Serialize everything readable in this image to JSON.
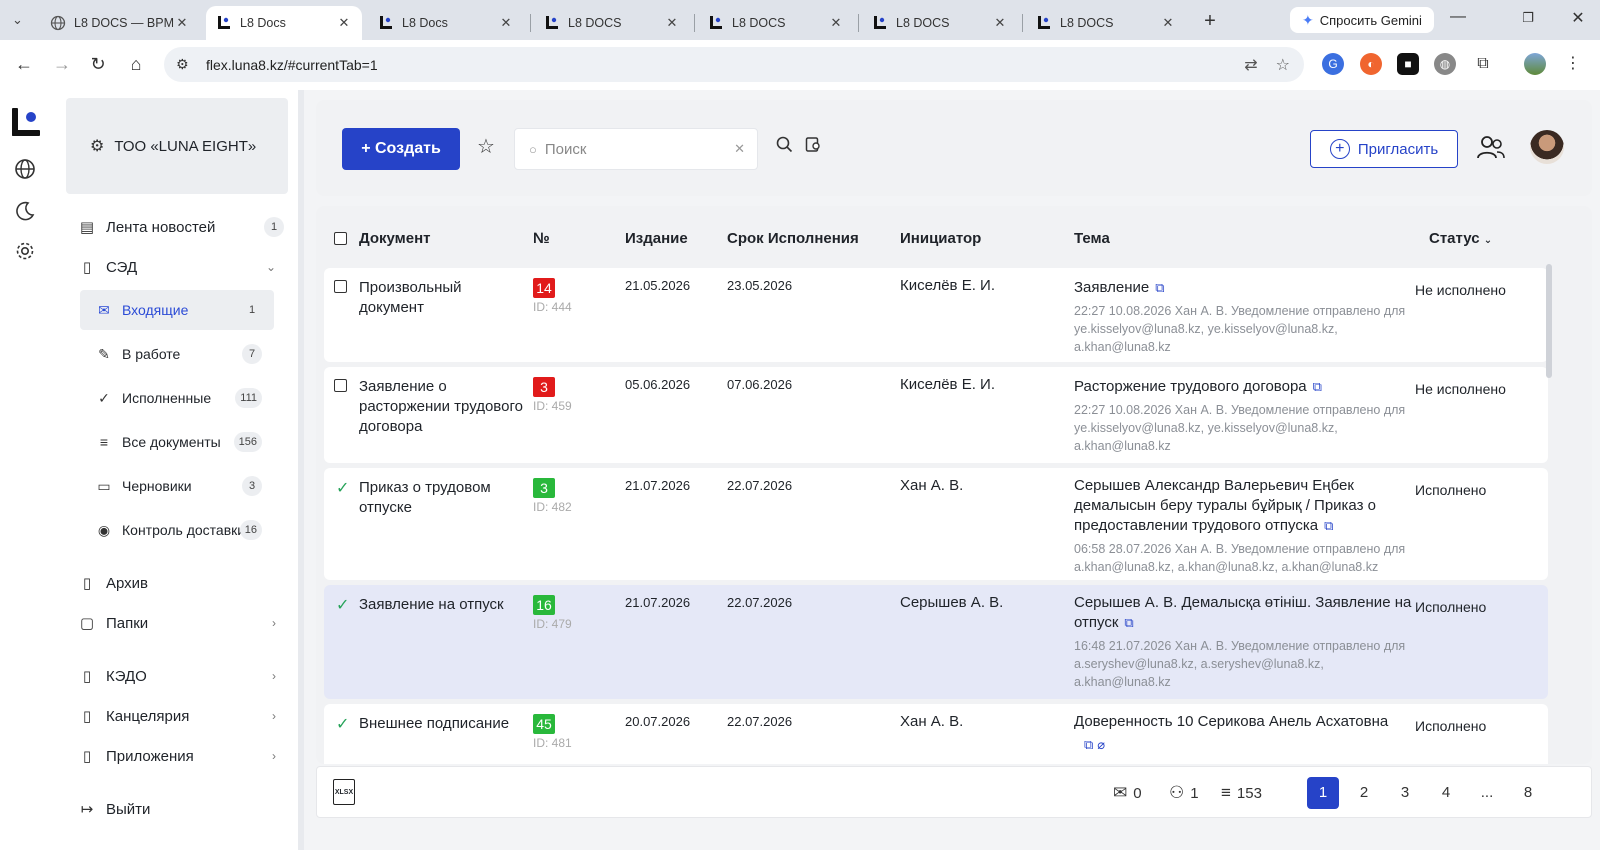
{
  "browser": {
    "tabs": [
      {
        "title": "L8 DOCS — BPM",
        "icon": "globe-icon",
        "active": false
      },
      {
        "title": "L8 Docs",
        "icon": "l8-logo-icon",
        "active": true
      },
      {
        "title": "L8 Docs",
        "icon": "l8-logo-icon",
        "active": false
      },
      {
        "title": "L8 DOCS",
        "icon": "l8-logo-icon",
        "active": false
      },
      {
        "title": "L8 DOCS",
        "icon": "l8-logo-icon",
        "active": false
      },
      {
        "title": "L8 DOCS",
        "icon": "l8-logo-icon",
        "active": false
      },
      {
        "title": "L8 DOCS",
        "icon": "l8-logo-icon",
        "active": false
      }
    ],
    "gemini_label": "Спросить Gemini",
    "url": "flex.luna8.kz/#currentTab=1"
  },
  "sidebar": {
    "org_name": "ТОО «LUNA EIGHT»",
    "news": {
      "label": "Лента новостей",
      "count": "1"
    },
    "sed": {
      "label": "СЭД"
    },
    "sub_items": [
      {
        "label": "Входящие",
        "count": "1",
        "icon": "mail-icon"
      },
      {
        "label": "В работе",
        "count": "7",
        "icon": "pencil-icon"
      },
      {
        "label": "Исполненные",
        "count": "111",
        "icon": "check-circle-icon"
      },
      {
        "label": "Все документы",
        "count": "156",
        "icon": "list-icon"
      },
      {
        "label": "Черновики",
        "count": "3",
        "icon": "draft-icon"
      },
      {
        "label": "Контроль доставки",
        "count": "16",
        "icon": "eye-icon"
      }
    ],
    "archive": "Архив",
    "folders": "Папки",
    "kedo": "КЭДО",
    "office": "Канцелярия",
    "apps": "Приложения",
    "logout": "Выйти"
  },
  "toolbar": {
    "create_label": "+ Создать",
    "search_placeholder": "Поиск",
    "invite_label": "Пригласить"
  },
  "table": {
    "headers": {
      "document": "Документ",
      "number": "№",
      "issued": "Издание",
      "due": "Срок Исполнения",
      "initiator": "Инициатор",
      "topic": "Тема",
      "status": "Статус"
    },
    "rows": [
      {
        "doc": "Произвольный документ",
        "num": "14",
        "num_color": "red",
        "id": "ID: 444",
        "issued": "21.05.2026",
        "due": "23.05.2026",
        "initiator": "Киселёв Е. И.",
        "topic": "Заявление",
        "note": "22:27 10.08.2026 Хан А. В. Уведомление отправлено для ye.kisselyov@luna8.kz, ye.kisselyov@luna8.kz, a.khan@luna8.kz",
        "status": "Не исполнено",
        "done": false
      },
      {
        "doc": "Заявление о расторжении трудового договора",
        "num": "3",
        "num_color": "red",
        "id": "ID: 459",
        "issued": "05.06.2026",
        "due": "07.06.2026",
        "initiator": "Киселёв Е. И.",
        "topic": "Расторжение трудового договора",
        "note": "22:27 10.08.2026 Хан А. В. Уведомление отправлено для ye.kisselyov@luna8.kz, ye.kisselyov@luna8.kz, a.khan@luna8.kz",
        "status": "Не исполнено",
        "done": false
      },
      {
        "doc": "Приказ о трудовом отпуске",
        "num": "3",
        "num_color": "green",
        "id": "ID: 482",
        "issued": "21.07.2026",
        "due": "22.07.2026",
        "initiator": "Хан А. В.",
        "topic": "Серышев Александр Валерьевич Еңбек демалысын беру туралы бұйрық / Приказ о предоставлении трудового отпуска",
        "note": "06:58 28.07.2026 Хан А. В. Уведомление отправлено для a.khan@luna8.kz, a.khan@luna8.kz, a.khan@luna8.kz",
        "status": "Исполнено",
        "done": true
      },
      {
        "doc": "Заявление на отпуск",
        "num": "16",
        "num_color": "green",
        "id": "ID: 479",
        "issued": "21.07.2026",
        "due": "22.07.2026",
        "initiator": "Серышев А. В.",
        "topic": "Серышев А. В. Демалысқа өтініш. Заявление на отпуск",
        "note": "16:48 21.07.2026 Хан А. В. Уведомление отправлено для a.seryshev@luna8.kz, a.seryshev@luna8.kz, a.khan@luna8.kz",
        "status": "Исполнено",
        "done": true
      },
      {
        "doc": "Внешнее подписание",
        "num": "45",
        "num_color": "green",
        "id": "ID: 481",
        "issued": "20.07.2026",
        "due": "22.07.2026",
        "initiator": "Хан А. В.",
        "topic": "Доверенность 10 Серикова Анель Асхатовна",
        "note": "",
        "status": "Исполнено",
        "done": true
      }
    ]
  },
  "footer": {
    "xlsx_label": "XLSX",
    "mail_count": "0",
    "user_count": "1",
    "total_count": "153",
    "pages": [
      "1",
      "2",
      "3",
      "4",
      "...",
      "8"
    ],
    "current_page": "1"
  },
  "colors": {
    "accent": "#2643c8",
    "badge_red": "#e11b1b",
    "badge_green": "#29b83b",
    "highlight_row": "#e5e8f7"
  }
}
